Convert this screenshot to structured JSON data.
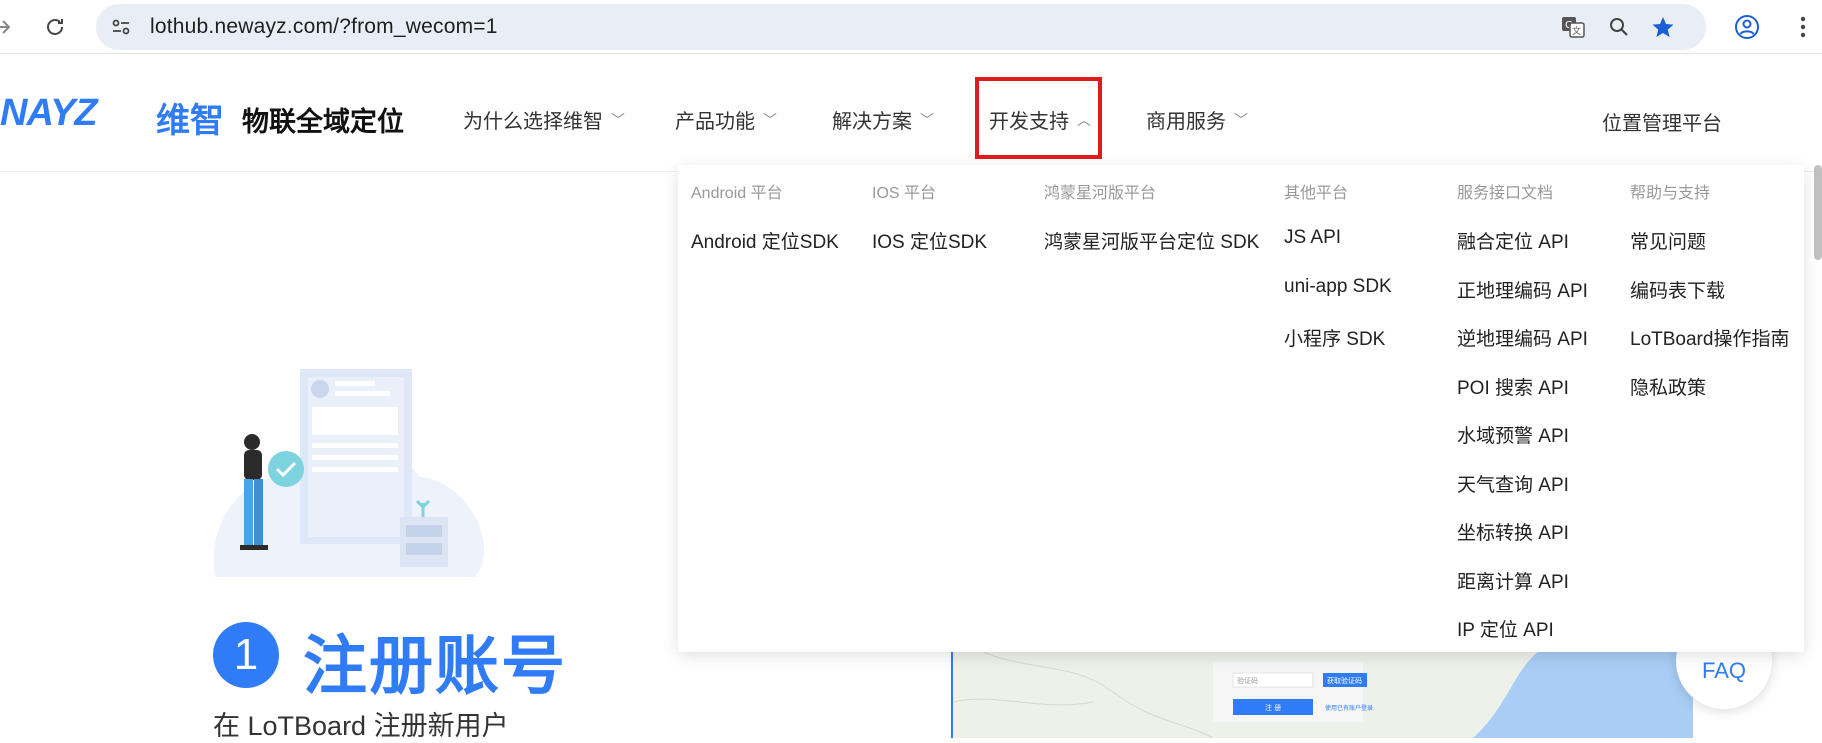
{
  "browser": {
    "url": "lothub.newayz.com/?from_wecom=1"
  },
  "site": {
    "logo_latin": "NAYZ",
    "logo_cn": "维智",
    "slogan": "物联全域定位",
    "nav": [
      {
        "label": "为什么选择维智"
      },
      {
        "label": "产品功能"
      },
      {
        "label": "解决方案"
      },
      {
        "label": "开发支持"
      },
      {
        "label": "商用服务"
      }
    ],
    "nav_right": "位置管理平台"
  },
  "dropdown": {
    "columns": [
      {
        "header": "Android 平台",
        "items": [
          "Android 定位SDK"
        ]
      },
      {
        "header": "IOS 平台",
        "items": [
          "IOS 定位SDK"
        ]
      },
      {
        "header": "鸿蒙星河版平台",
        "items": [
          "鸿蒙星河版平台定位 SDK"
        ]
      },
      {
        "header": "其他平台",
        "items": [
          "JS API",
          "uni-app SDK",
          "小程序 SDK"
        ]
      },
      {
        "header": "服务接口文档",
        "items": [
          "融合定位 API",
          "正地理编码 API",
          "逆地理编码 API",
          "POI 搜索 API",
          "水域预警 API",
          "天气查询 API",
          "坐标转换 API",
          "距离计算 API",
          "IP 定位 API"
        ]
      },
      {
        "header": "帮助与支持",
        "items": [
          "常见问题",
          "编码表下载",
          "LoTBoard操作指南",
          "隐私政策"
        ]
      }
    ]
  },
  "content": {
    "step_number": "1",
    "step_title": "注册账号",
    "step_subtitle": "在 LoTBoard 注册新用户",
    "faq_label": "FAQ",
    "map_form": {
      "code_placeholder": "验证码",
      "get_code": "获取验证码",
      "register": "注 册",
      "login_link": "使用已有账户登录"
    }
  },
  "colors": {
    "brand_blue": "#2f7cf6",
    "highlight_red": "#e01b1b",
    "omnibox_bg": "#e9eef6"
  }
}
